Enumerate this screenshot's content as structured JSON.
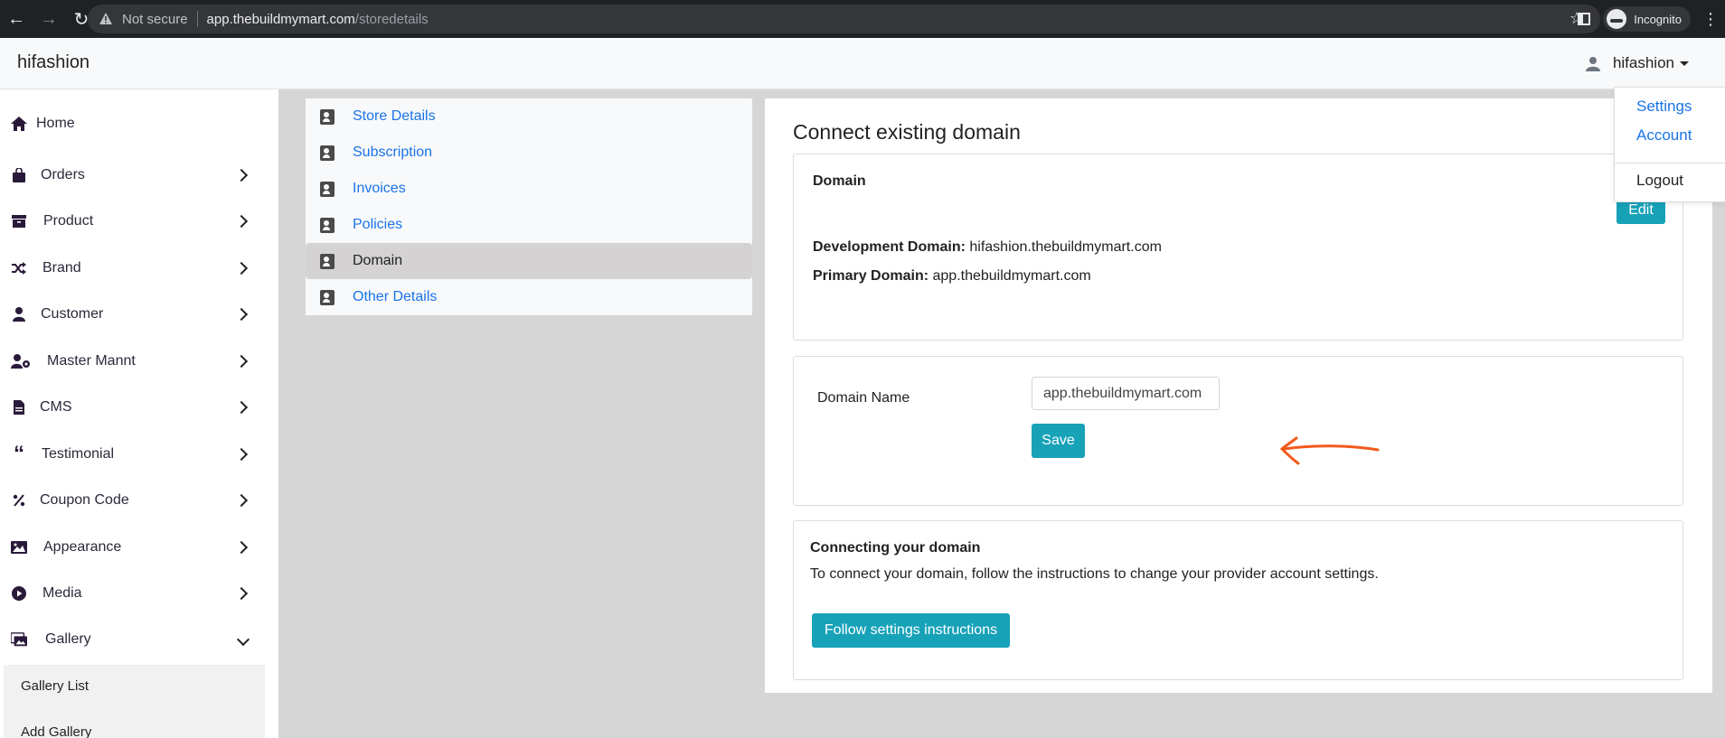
{
  "browser": {
    "security_label": "Not secure",
    "url_host": "app.thebuildmymart.com",
    "url_path": "/storedetails",
    "profile_label": "Incognito"
  },
  "header": {
    "brand": "hifashion",
    "user_name": "hifashion"
  },
  "user_dropdown": {
    "items": [
      "Settings",
      "Account",
      "Logout"
    ]
  },
  "sidebar": {
    "items": [
      {
        "label": "Home",
        "icon": "home-icon"
      },
      {
        "label": "Orders",
        "icon": "shopping-bag-icon"
      },
      {
        "label": "Product",
        "icon": "box-icon"
      },
      {
        "label": "Brand",
        "icon": "shuffle-icon"
      },
      {
        "label": "Customer",
        "icon": "user-icon"
      },
      {
        "label": "Master Mannt",
        "icon": "user-cog-icon"
      },
      {
        "label": "CMS",
        "icon": "file-icon"
      },
      {
        "label": "Testimonial",
        "icon": "quote-icon"
      },
      {
        "label": "Coupon Code",
        "icon": "percent-icon"
      },
      {
        "label": "Appearance",
        "icon": "image-icon"
      },
      {
        "label": "Media",
        "icon": "play-circle-icon"
      },
      {
        "label": "Gallery",
        "icon": "images-icon"
      }
    ],
    "gallery_submenu": [
      "Gallery List",
      "Add Gallery"
    ]
  },
  "settings_nav": {
    "items": [
      "Store Details",
      "Subscription",
      "Invoices",
      "Policies",
      "Domain",
      "Other Details"
    ],
    "active": "Domain"
  },
  "main": {
    "title": "Connect existing domain",
    "domain_card": {
      "title": "Domain",
      "edit_label": "Edit",
      "dev_label": "Development Domain:",
      "dev_value": "hifashion.thebuildmymart.com",
      "primary_label": "Primary Domain:",
      "primary_value": "app.thebuildmymart.com"
    },
    "form": {
      "label": "Domain Name",
      "value": "app.thebuildmymart.com",
      "save_label": "Save"
    },
    "connect_card": {
      "title": "Connecting your domain",
      "text": "To connect your domain, follow the instructions to change your provider account settings.",
      "button_label": "Follow settings instructions"
    }
  },
  "colors": {
    "accent": "#17a2b8",
    "link": "#1a73e8",
    "annotation_arrow": "#f25a1c"
  }
}
